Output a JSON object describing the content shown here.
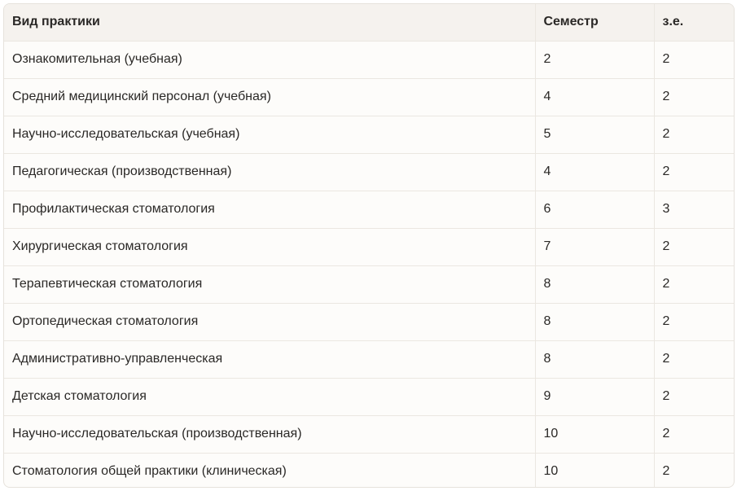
{
  "table": {
    "headers": [
      "Вид практики",
      "Семестр",
      "з.е."
    ],
    "rows": [
      {
        "name": "Ознакомительная (учебная)",
        "semester": "2",
        "credits": "2"
      },
      {
        "name": "Средний медицинский персонал (учебная)",
        "semester": "4",
        "credits": "2"
      },
      {
        "name": "Научно-исследовательская (учебная)",
        "semester": "5",
        "credits": "2"
      },
      {
        "name": "Педагогическая (производственная)",
        "semester": "4",
        "credits": "2"
      },
      {
        "name": "Профилактическая стоматология",
        "semester": "6",
        "credits": "3"
      },
      {
        "name": "Хирургическая стоматология",
        "semester": "7",
        "credits": "2"
      },
      {
        "name": "Терапевтическая стоматология",
        "semester": "8",
        "credits": "2"
      },
      {
        "name": "Ортопедическая стоматология",
        "semester": "8",
        "credits": "2"
      },
      {
        "name": "Административно-управленческая",
        "semester": "8",
        "credits": "2"
      },
      {
        "name": "Детская стоматология",
        "semester": "9",
        "credits": "2"
      },
      {
        "name": "Научно-исследовательская (производственная)",
        "semester": "10",
        "credits": "2"
      },
      {
        "name": "Стоматология общей практики (клиническая)",
        "semester": "10",
        "credits": "2"
      }
    ]
  }
}
